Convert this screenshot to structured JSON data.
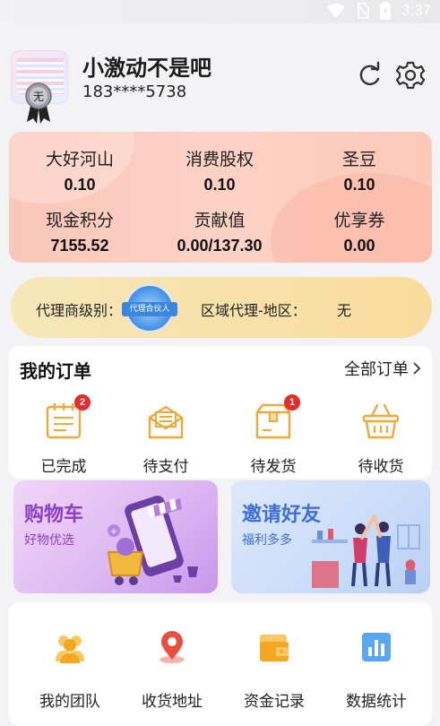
{
  "status_bar": {
    "time": "3:37"
  },
  "profile": {
    "username": "小激动不是吧",
    "phone": "183****5738",
    "medal_text": "无"
  },
  "assets": [
    {
      "label": "大好河山",
      "value": "0.10"
    },
    {
      "label": "消费股权",
      "value": "0.10"
    },
    {
      "label": "圣豆",
      "value": "0.10"
    },
    {
      "label": "现金积分",
      "value": "7155.52"
    },
    {
      "label": "贡献值",
      "value": "0.00/137.30"
    },
    {
      "label": "优享券",
      "value": "0.00"
    }
  ],
  "agent": {
    "level_label": "代理商级别：",
    "level_badge": "代理合伙人",
    "region_label": "区域代理-地区：",
    "region_value": "无"
  },
  "orders": {
    "title": "我的订单",
    "all_label": "全部订单",
    "items": [
      {
        "label": "已完成",
        "icon": "completed-list-icon",
        "badge": "2"
      },
      {
        "label": "待支付",
        "icon": "envelope-pay-icon",
        "badge": ""
      },
      {
        "label": "待发货",
        "icon": "package-box-icon",
        "badge": "1"
      },
      {
        "label": "待收货",
        "icon": "basket-icon",
        "badge": ""
      }
    ]
  },
  "promos": {
    "cart": {
      "title": "购物车",
      "subtitle": "好物优选"
    },
    "invite": {
      "title": "邀请好友",
      "subtitle": "福利多多"
    }
  },
  "tools": [
    {
      "label": "我的团队",
      "icon": "team-icon"
    },
    {
      "label": "收货地址",
      "icon": "location-pin-icon"
    },
    {
      "label": "资金记录",
      "icon": "wallet-icon"
    },
    {
      "label": "数据统计",
      "icon": "bar-chart-icon"
    }
  ],
  "colors": {
    "accent_red": "#e52b2b",
    "assets_bg": "#fcc8b9",
    "agent_bg": "#f8dc9d",
    "order_icon": "#f0a83a",
    "cart_purple": "#8c3fc5",
    "invite_blue": "#3d6fd4"
  }
}
